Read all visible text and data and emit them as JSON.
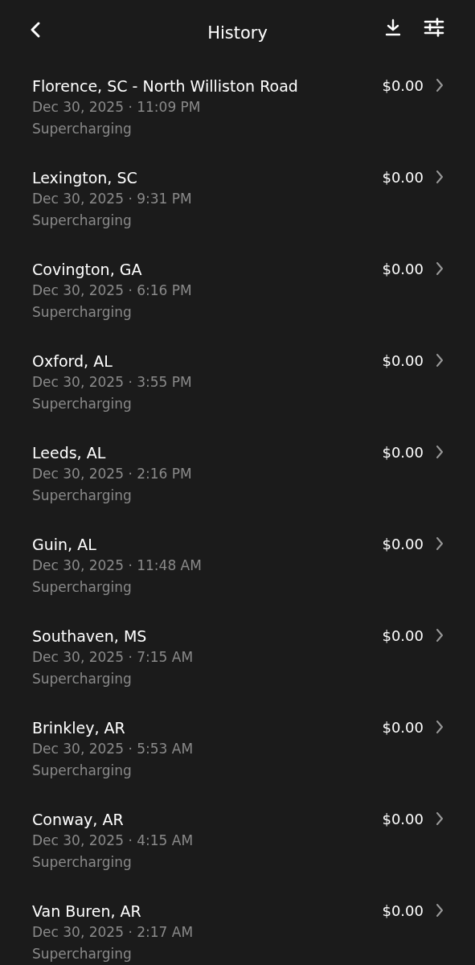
{
  "header": {
    "title": "History"
  },
  "sessions": [
    {
      "location": "Florence, SC - North Williston Road",
      "datetime": "Dec 30, 2025 · 11:09 PM",
      "type": "Supercharging",
      "amount": "$0.00"
    },
    {
      "location": "Lexington, SC",
      "datetime": "Dec 30, 2025 · 9:31 PM",
      "type": "Supercharging",
      "amount": "$0.00"
    },
    {
      "location": "Covington, GA",
      "datetime": "Dec 30, 2025 · 6:16 PM",
      "type": "Supercharging",
      "amount": "$0.00"
    },
    {
      "location": "Oxford, AL",
      "datetime": "Dec 30, 2025 · 3:55 PM",
      "type": "Supercharging",
      "amount": "$0.00"
    },
    {
      "location": "Leeds, AL",
      "datetime": "Dec 30, 2025 · 2:16 PM",
      "type": "Supercharging",
      "amount": "$0.00"
    },
    {
      "location": "Guin, AL",
      "datetime": "Dec 30, 2025 · 11:48 AM",
      "type": "Supercharging",
      "amount": "$0.00"
    },
    {
      "location": "Southaven, MS",
      "datetime": "Dec 30, 2025 · 7:15 AM",
      "type": "Supercharging",
      "amount": "$0.00"
    },
    {
      "location": "Brinkley, AR",
      "datetime": "Dec 30, 2025 · 5:53 AM",
      "type": "Supercharging",
      "amount": "$0.00"
    },
    {
      "location": "Conway, AR",
      "datetime": "Dec 30, 2025 · 4:15 AM",
      "type": "Supercharging",
      "amount": "$0.00"
    },
    {
      "location": "Van Buren, AR",
      "datetime": "Dec 30, 2025 · 2:17 AM",
      "type": "Supercharging",
      "amount": "$0.00"
    }
  ]
}
